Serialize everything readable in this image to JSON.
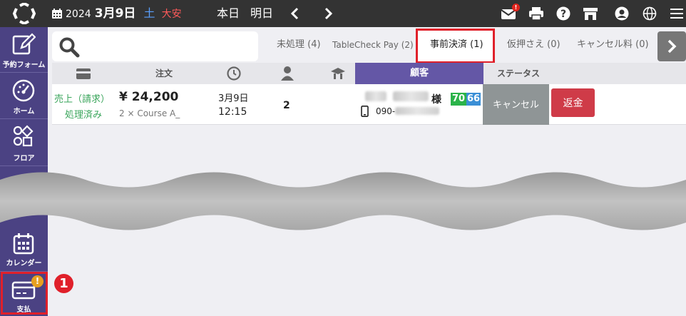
{
  "header": {
    "year": "2024",
    "month_day": "3月9日",
    "day_of_week": "土",
    "rokuyo": "大安",
    "today_label": "本日",
    "tomorrow_label": "明日",
    "mail_badge": "!"
  },
  "sidebar": {
    "items": [
      {
        "label": "予約フォーム",
        "icon": "edit-icon"
      },
      {
        "label": "ホーム",
        "icon": "dashboard-icon"
      },
      {
        "label": "フロア",
        "icon": "floor-shapes-icon"
      },
      {
        "label": "カレンダー",
        "icon": "calendar-icon"
      },
      {
        "label": "支払",
        "icon": "credit-card-icon",
        "badge": "!"
      }
    ]
  },
  "search": {
    "placeholder": ""
  },
  "tabs": [
    {
      "label": "未処理 (4)"
    },
    {
      "label": "TableCheck Pay (2)"
    },
    {
      "label": "事前決済 (1)",
      "active": true
    },
    {
      "label": "仮押さえ (0)"
    },
    {
      "label": "キャンセル料 (0)"
    }
  ],
  "table": {
    "headers": {
      "order": "注文",
      "customer": "顧客",
      "status": "ステータス"
    },
    "rows": [
      {
        "payment_type": "売上（請求）",
        "payment_status": "処理済み",
        "amount": "¥ 24,200",
        "items": "2 × Course A_",
        "date": "3月9日",
        "time": "12:15",
        "guests": "2",
        "honorific": "様",
        "phone_prefix": "090-",
        "score_a": "70",
        "score_b": "66",
        "cancel_label": "キャンセル",
        "refund_label": "返金"
      }
    ]
  },
  "annotation": {
    "step": "1"
  },
  "colors": {
    "topbar": "#333333",
    "sidebar": "#4b4283",
    "customer_header": "#6457a6",
    "highlight_red": "#e0202a",
    "score_green": "#2bb34a",
    "score_blue": "#3a8fd6",
    "refund_red": "#cf3b48",
    "cancel_gray": "#8f9596"
  }
}
